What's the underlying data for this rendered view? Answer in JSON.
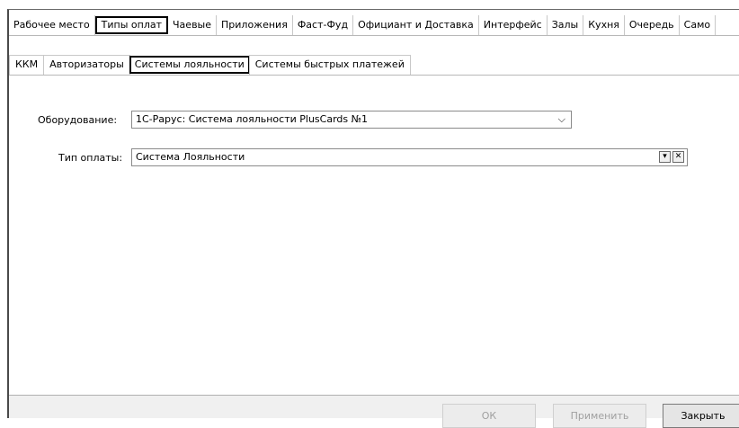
{
  "tabs_main": [
    {
      "label": "Рабочее место"
    },
    {
      "label": "Типы оплат"
    },
    {
      "label": "Чаевые"
    },
    {
      "label": "Приложения"
    },
    {
      "label": "Фаст-Фуд"
    },
    {
      "label": "Официант и Доставка"
    },
    {
      "label": "Интерфейс"
    },
    {
      "label": "Залы"
    },
    {
      "label": "Кухня"
    },
    {
      "label": "Очередь"
    },
    {
      "label": "Само"
    }
  ],
  "tabs_sub": [
    {
      "label": "ККМ"
    },
    {
      "label": "Авторизаторы"
    },
    {
      "label": "Системы лояльности"
    },
    {
      "label": "Системы быстрых платежей"
    }
  ],
  "form": {
    "equipment_label": "Оборудование:",
    "equipment_value": "1С-Рарус: Система лояльности PlusCards №1",
    "payment_type_label": "Тип оплаты:",
    "payment_type_value": "Система Лояльности"
  },
  "icons": {
    "chevron": "⌵",
    "dropdown": "▾",
    "clear": "✕"
  },
  "buttons": {
    "ok": "ОК",
    "apply": "Применить",
    "close": "Закрыть"
  }
}
